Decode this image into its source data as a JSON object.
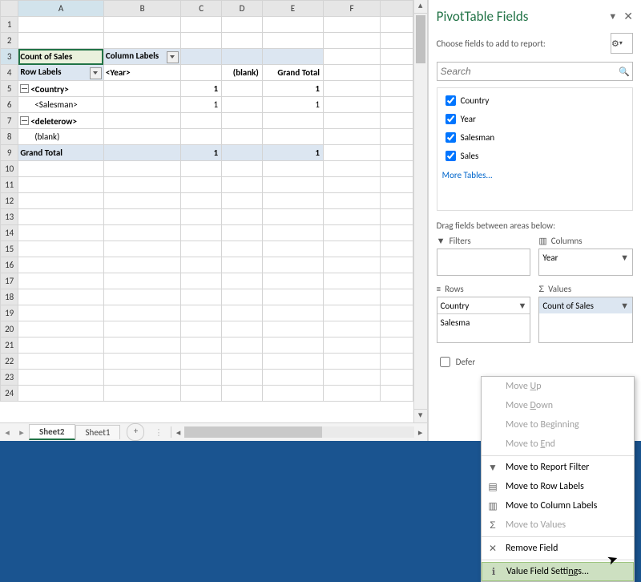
{
  "sheet": {
    "columns": [
      "A",
      "B",
      "C",
      "D",
      "E",
      "F"
    ],
    "row_numbers": [
      1,
      2,
      3,
      4,
      5,
      6,
      7,
      8,
      9,
      10,
      11,
      12,
      13,
      14,
      15,
      16,
      17,
      18,
      19,
      20,
      21,
      22,
      23,
      24
    ],
    "pivot": {
      "r3": {
        "a": "Count of Sales",
        "b": "Column Labels"
      },
      "r4": {
        "a": "Row Labels",
        "b": "<Year>",
        "d": "(blank)",
        "e": "Grand Total"
      },
      "r5": {
        "a": "<Country>",
        "c": "1",
        "e": "1"
      },
      "r6": {
        "a": "<Salesman>",
        "c": "1",
        "e": "1"
      },
      "r7": {
        "a": "<deleterow>"
      },
      "r8": {
        "a": "(blank)"
      },
      "r9": {
        "a": "Grand Total",
        "c": "1",
        "e": "1"
      }
    },
    "tabs": {
      "active": "Sheet2",
      "inactive": "Sheet1"
    }
  },
  "taskpane": {
    "title": "PivotTable Fields",
    "subtitle": "Choose fields to add to report:",
    "search_placeholder": "Search",
    "fields": [
      "Country",
      "Year",
      "Salesman",
      "Sales"
    ],
    "more_tables": "More Tables...",
    "areas_label": "Drag fields between areas below:",
    "filters_label": "Filters",
    "columns_label": "Columns",
    "rows_label": "Rows",
    "values_label": "Values",
    "columns_pill": "Year",
    "rows_pill1": "Country",
    "rows_pill2": "Salesma",
    "values_pill": "Count of Sales",
    "defer": "Defer"
  },
  "ctx": {
    "move_up": "Move Up",
    "move_down": "Move Down",
    "move_begin": "Move to Beginning",
    "move_end": "Move to End",
    "to_report": "Move to Report Filter",
    "to_row": "Move to Row Labels",
    "to_col": "Move to Column Labels",
    "to_val": "Move to Values",
    "remove": "Remove Field",
    "vfs": "Value Field Settings..."
  }
}
